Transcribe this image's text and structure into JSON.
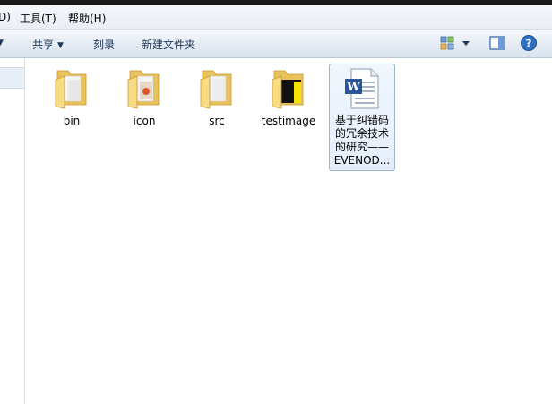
{
  "menubar": {
    "partial_item": "D)",
    "items": [
      "工具(T)",
      "帮助(H)"
    ]
  },
  "toolbar": {
    "share_label": "共享",
    "burn_label": "刻录",
    "new_folder_label": "新建文件夹"
  },
  "files": [
    {
      "name": "bin",
      "type": "folder"
    },
    {
      "name": "icon",
      "type": "folder"
    },
    {
      "name": "src",
      "type": "folder"
    },
    {
      "name": "testimage",
      "type": "folder"
    },
    {
      "name": "基于纠错码的冗余技术的研究——EVENOD...",
      "type": "word-document",
      "line1": "基于纠错码",
      "line2": "的冗余技术",
      "line3": "的研究——",
      "line4": "EVENOD..."
    }
  ],
  "colors": {
    "folder": "#f3d97a",
    "selection_border": "#99b4d4",
    "word_blue": "#2b579a",
    "help_blue": "#2f6fc0"
  }
}
